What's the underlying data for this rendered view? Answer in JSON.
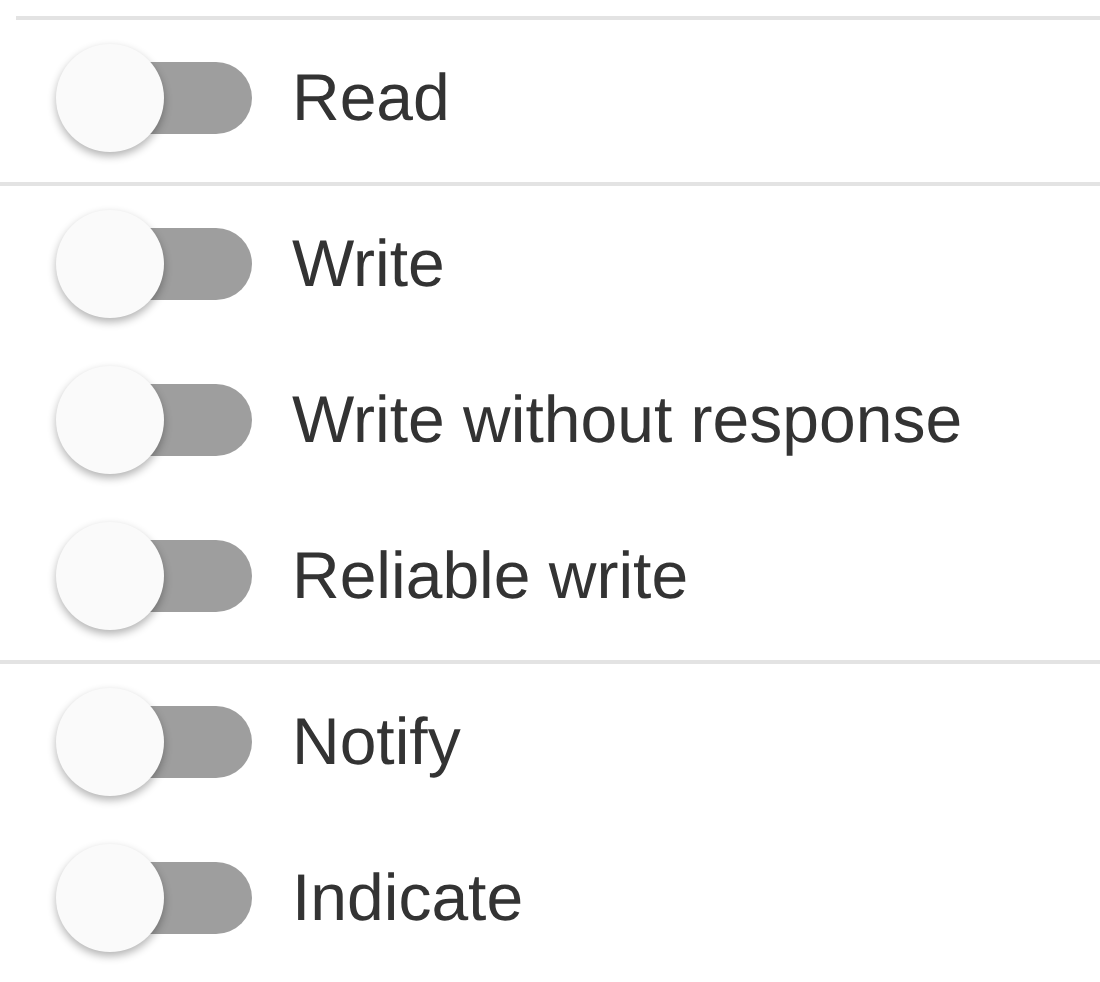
{
  "groups": [
    {
      "items": [
        {
          "label": "Read",
          "on": false
        }
      ]
    },
    {
      "items": [
        {
          "label": "Write",
          "on": false
        },
        {
          "label": "Write without response",
          "on": false
        },
        {
          "label": "Reliable write",
          "on": false
        }
      ]
    },
    {
      "items": [
        {
          "label": "Notify",
          "on": false
        },
        {
          "label": "Indicate",
          "on": false
        }
      ]
    }
  ]
}
